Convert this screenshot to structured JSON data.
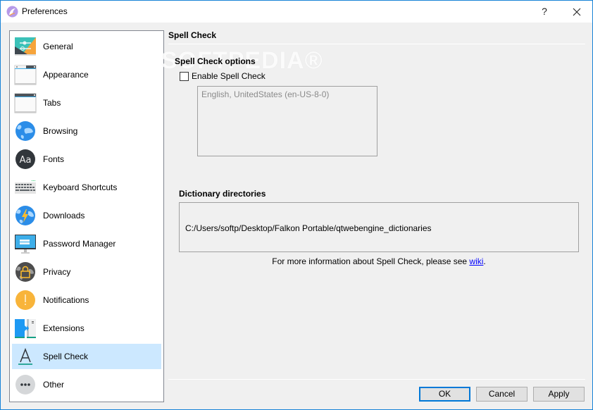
{
  "window": {
    "title": "Preferences",
    "help_label": "?",
    "close_label": "✕",
    "app_icon": "falkon-logo-icon"
  },
  "sidebar": {
    "selected": "Spell Check",
    "items": [
      {
        "label": "General",
        "icon": "general-settings-icon"
      },
      {
        "label": "Appearance",
        "icon": "window-appearance-icon"
      },
      {
        "label": "Tabs",
        "icon": "tabs-window-icon"
      },
      {
        "label": "Browsing",
        "icon": "globe-icon"
      },
      {
        "label": "Fonts",
        "icon": "fonts-aa-icon"
      },
      {
        "label": "Keyboard Shortcuts",
        "icon": "keyboard-icon"
      },
      {
        "label": "Downloads",
        "icon": "globe-lightning-icon"
      },
      {
        "label": "Password Manager",
        "icon": "monitor-password-icon"
      },
      {
        "label": "Privacy",
        "icon": "globe-lock-icon"
      },
      {
        "label": "Notifications",
        "icon": "exclamation-icon"
      },
      {
        "label": "Extensions",
        "icon": "puzzle-extensions-icon"
      },
      {
        "label": "Spell Check",
        "icon": "letter-a-icon"
      },
      {
        "label": "Other",
        "icon": "more-dots-icon"
      }
    ]
  },
  "page": {
    "title": "Spell Check",
    "watermark": "SOFTPEDIA®",
    "options_title": "Spell Check options",
    "enable_label": "Enable Spell Check",
    "enable_checked": false,
    "languages": [
      "English, UnitedStates (en-US-8-0)"
    ],
    "dictionary_title": "Dictionary directories",
    "dictionaries": [
      "C:/Users/softp/Desktop/Falkon Portable/qtwebengine_dictionaries"
    ],
    "info_prefix": "For more information about Spell Check, please see ",
    "info_link": "wiki",
    "info_suffix": "."
  },
  "buttons": {
    "ok": "OK",
    "cancel": "Cancel",
    "apply": "Apply"
  },
  "colors": {
    "accent": "#0078d7",
    "selected_bg": "#cce8ff",
    "link": "#0000ff"
  }
}
